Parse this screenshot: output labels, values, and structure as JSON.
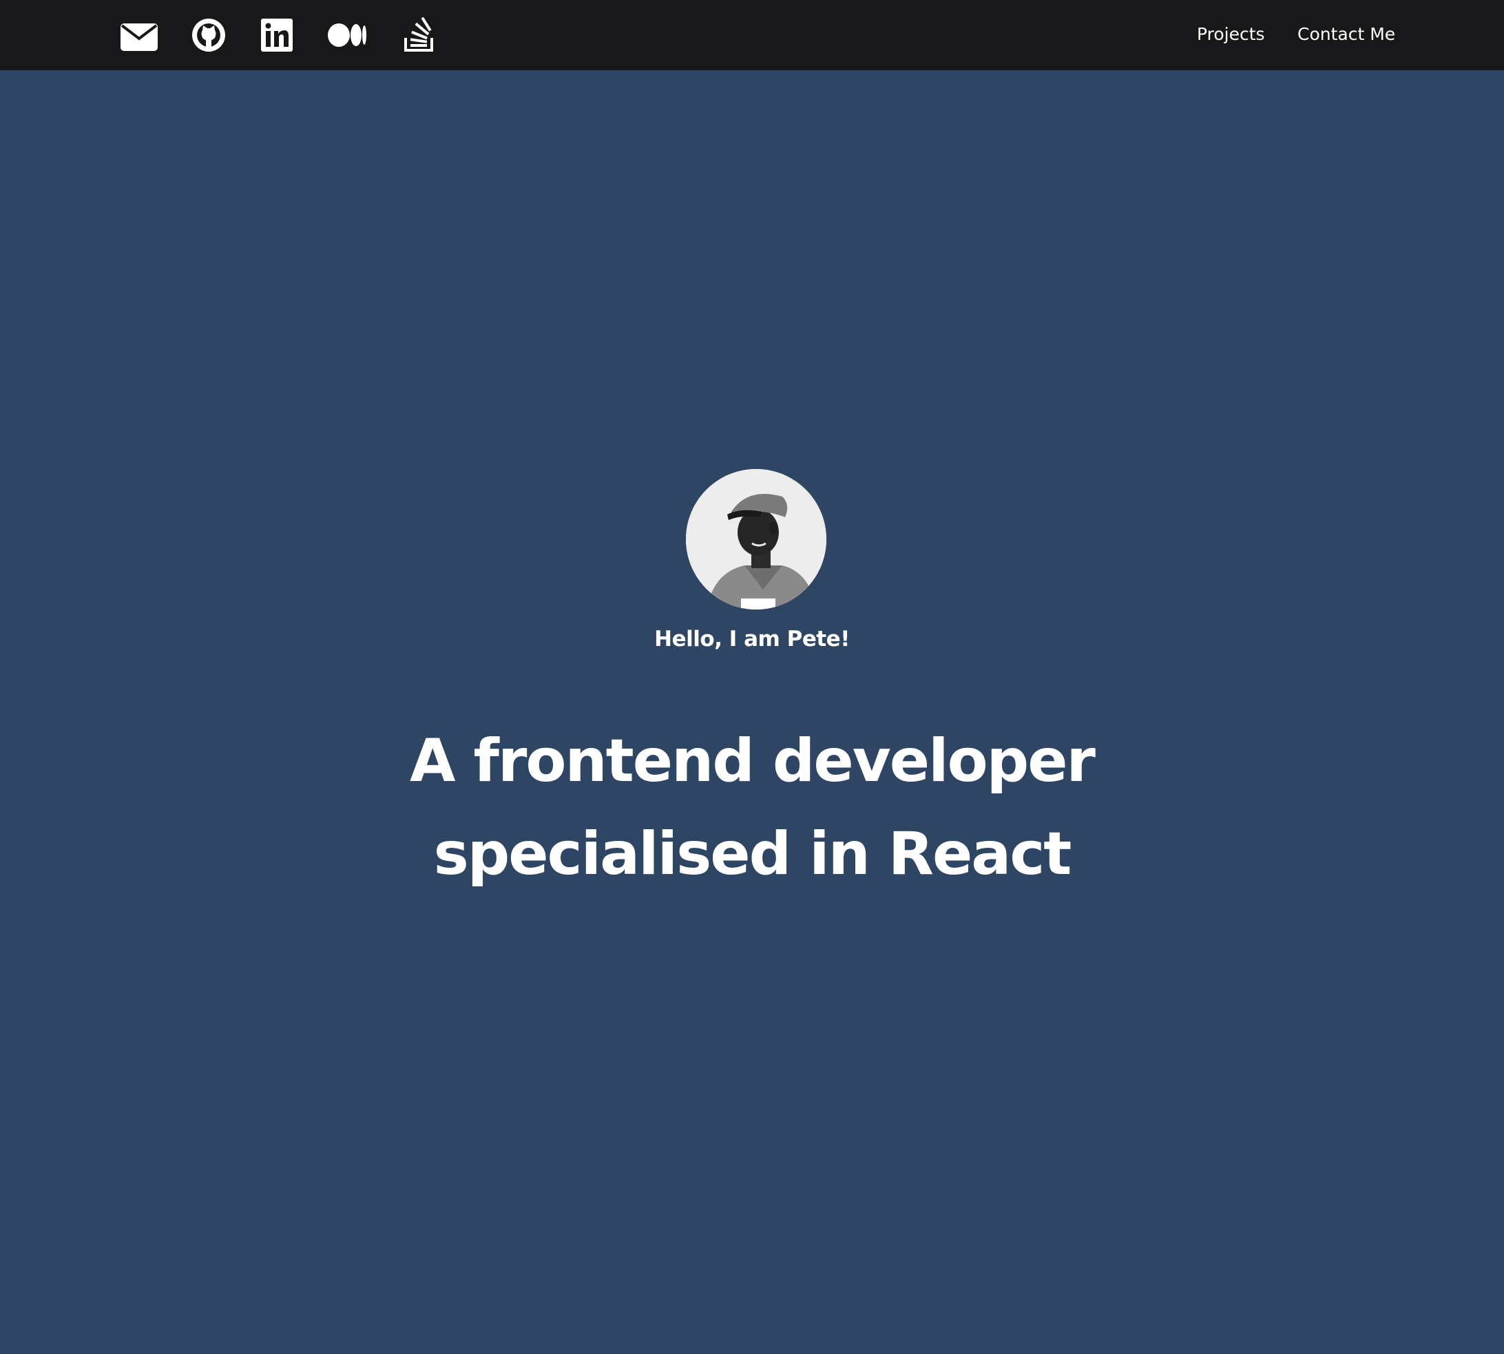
{
  "header": {
    "social_icons": [
      {
        "name": "envelope-icon"
      },
      {
        "name": "github-icon"
      },
      {
        "name": "linkedin-icon"
      },
      {
        "name": "medium-icon"
      },
      {
        "name": "stack-overflow-icon"
      }
    ],
    "nav": {
      "projects_label": "Projects",
      "contact_label": "Contact Me"
    }
  },
  "hero": {
    "avatar_alt": "Pete avatar",
    "greeting": "Hello, I am Pete!",
    "headline_line1": "A frontend developer",
    "headline_line2": "specialised in React"
  },
  "colors": {
    "header_background": "#18181b",
    "page_background": "#2e4564",
    "text": "#ffffff"
  }
}
